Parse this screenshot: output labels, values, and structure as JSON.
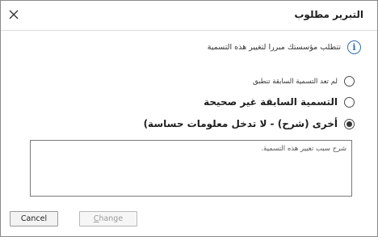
{
  "dialog": {
    "title": "التبرير مطلوب",
    "info_text": "تتطلب مؤسستك مبررا لتغيير هذه التسمية",
    "options": [
      {
        "label": "لم تعد التسمية السابقة تنطبق",
        "selected": false
      },
      {
        "label": "التسمية السابقة غير صحيحة",
        "selected": false
      },
      {
        "label": "أخرى (شرح) - لا تدخل معلومات حساسة)",
        "selected": true
      }
    ],
    "textarea": {
      "placeholder": "شرح سبب تغيير هذه التسمية."
    },
    "buttons": {
      "cancel": "Cancel",
      "change_first": "C",
      "change_rest": "hange"
    },
    "icons": {
      "close": "close-icon",
      "info": "info-icon"
    },
    "colors": {
      "info_accent": "#2f6fb6"
    }
  }
}
